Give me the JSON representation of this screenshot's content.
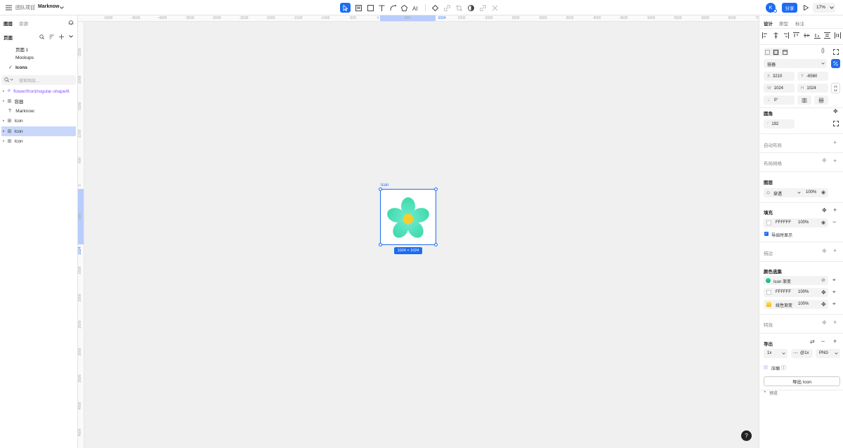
{
  "topbar": {
    "breadcrumb_team": "团队项目",
    "separator": "/",
    "project_name": "Marknow",
    "avatar_letter": "K",
    "share_label": "分享",
    "zoom_label": "17%"
  },
  "left_panel": {
    "tabs": [
      "图层",
      "资源"
    ],
    "pages_title": "页面",
    "pages": [
      "页面 1",
      "Mockups",
      "Icons"
    ],
    "search_placeholder": "搜索图层...",
    "layers": [
      {
        "name": "flower/front/regular-shape/6",
        "type": "component"
      },
      {
        "name": "容器",
        "type": "frame"
      },
      {
        "name": "Marknow",
        "type": "text"
      },
      {
        "name": "Icon",
        "type": "frame"
      },
      {
        "name": "Icon",
        "type": "frame",
        "selected": true
      },
      {
        "name": "Icon",
        "type": "frame"
      }
    ]
  },
  "canvas": {
    "frame_label": "Icon",
    "size_badge": "1024 × 1024",
    "ruler_top": [
      "-5000",
      "-4500",
      "-4000",
      "-3500",
      "-3000",
      "-2500",
      "-2000",
      "-1500",
      "-1000",
      "-500",
      "0",
      "500",
      "1024",
      "1500",
      "2000",
      "2500",
      "3000",
      "3500",
      "4000",
      "4500",
      "5000",
      "5500",
      "6000",
      "6500",
      "7000"
    ],
    "ruler_left": [
      "-2500",
      "-2000",
      "-1500",
      "-1000",
      "-500",
      "0",
      "500",
      "1024",
      "1500",
      "2000",
      "2500",
      "3000",
      "3500",
      "4000",
      "4500"
    ]
  },
  "right_panel": {
    "tabs": [
      "设计",
      "原型",
      "标注"
    ],
    "container_select": "容器",
    "x_label": "X",
    "x_value": "3210",
    "y_label": "Y",
    "y_value": "-6560",
    "w_label": "W",
    "w_value": "1024",
    "h_label": "H",
    "h_value": "1024",
    "rotation": "0°",
    "radius_title": "圆角",
    "radius_value": "192",
    "auto_layout": "自动布局",
    "layout_grid": "布局网格",
    "layer_title": "图层",
    "blend_mode": "穿透",
    "layer_opacity": "100%",
    "fill_title": "填充",
    "fill_hex": "FFFFFF",
    "fill_opacity": "100%",
    "show_in_export": "导出时显示",
    "stroke_title": "描边",
    "selection_colors_title": "颜色选集",
    "selection_colors": [
      {
        "name": "Icon 渐变",
        "opacity": ""
      },
      {
        "name": "FFFFFF",
        "opacity": "100%"
      },
      {
        "name": "线性渐变",
        "opacity": "100%"
      }
    ],
    "effects_title": "特效",
    "export_title": "导出",
    "export_scale": "1x",
    "export_suffix": "@1x",
    "export_format": "PNG",
    "compress_label": "压缩",
    "export_button": "导出 Icon",
    "preview_label": "预览"
  },
  "help_label": "?",
  "colors": {
    "accent": "#1d6cf2",
    "selection_band": "#b9ccfb",
    "flower_petal": "#33dbb0",
    "flower_center": "#f5cd2c",
    "component_purple": "#8a4fff"
  }
}
